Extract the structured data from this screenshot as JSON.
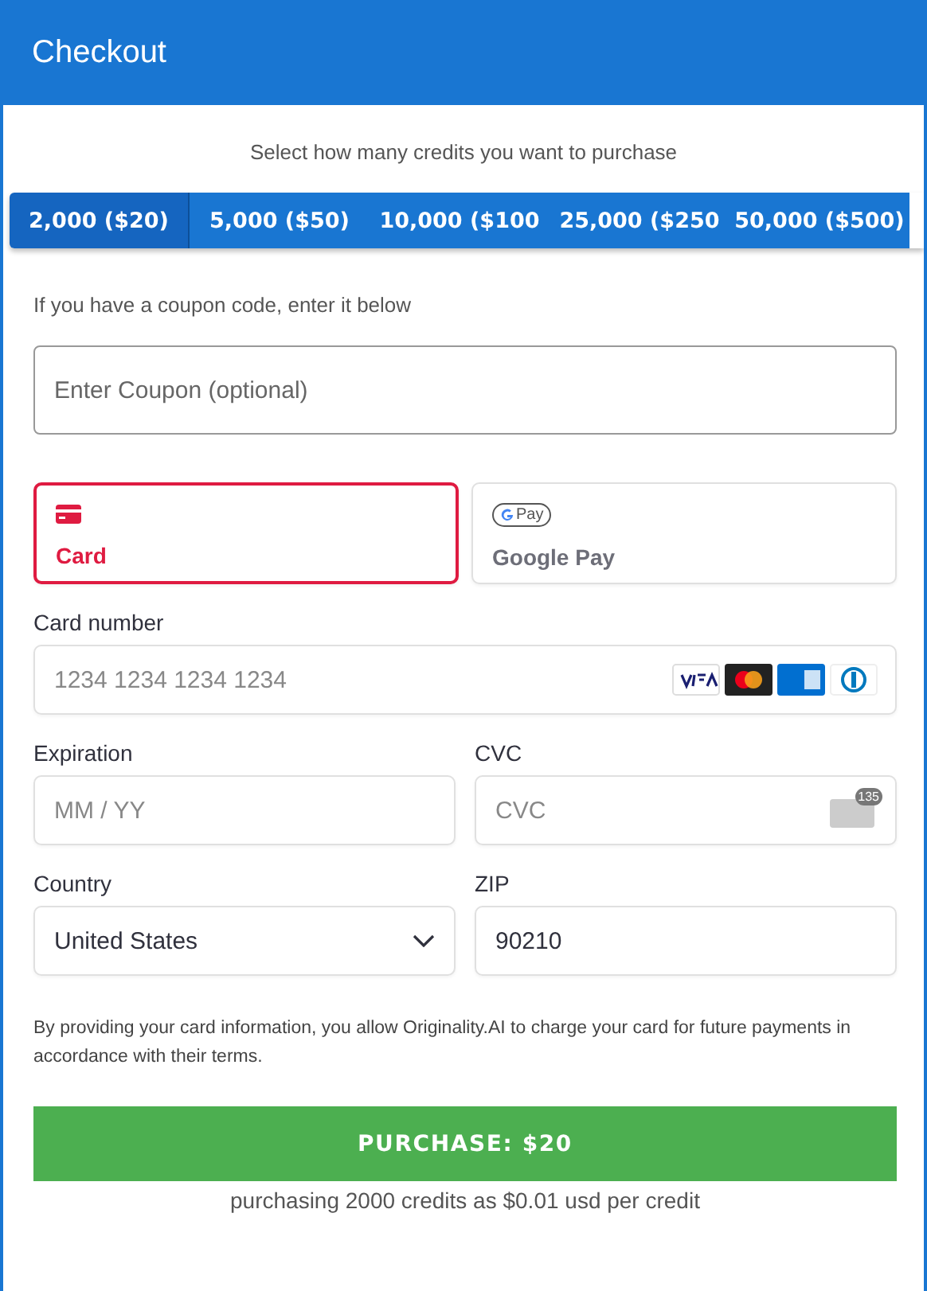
{
  "header": {
    "title": "Checkout"
  },
  "prompt": "Select how many credits you want to purchase",
  "credit_tabs": [
    {
      "label": "2,000 ($20)",
      "selected": true
    },
    {
      "label": "5,000 ($50)",
      "selected": false
    },
    {
      "label": "10,000 ($100",
      "selected": false
    },
    {
      "label": "25,000 ($250",
      "selected": false
    },
    {
      "label": "50,000 ($500)",
      "selected": false
    }
  ],
  "coupon": {
    "hint": "If you have a coupon code, enter it below",
    "placeholder": "Enter Coupon (optional)"
  },
  "payment_methods": [
    {
      "kind": "card",
      "label": "Card",
      "selected": true
    },
    {
      "kind": "gpay",
      "label": "Google Pay",
      "badge": "Pay",
      "selected": false
    }
  ],
  "card_number": {
    "label": "Card number",
    "placeholder": "1234 1234 1234 1234"
  },
  "expiration": {
    "label": "Expiration",
    "placeholder": "MM / YY"
  },
  "cvc": {
    "label": "CVC",
    "placeholder": "CVC",
    "badge": "135"
  },
  "country": {
    "label": "Country",
    "value": "United States"
  },
  "zip": {
    "label": "ZIP",
    "value": "90210"
  },
  "disclaimer": "By providing your card information, you allow Originality.AI to charge your card for future payments in accordance with their terms.",
  "purchase_button": "PURCHASE: $20",
  "summary": "purchasing 2000 credits as $0.01 usd per credit"
}
